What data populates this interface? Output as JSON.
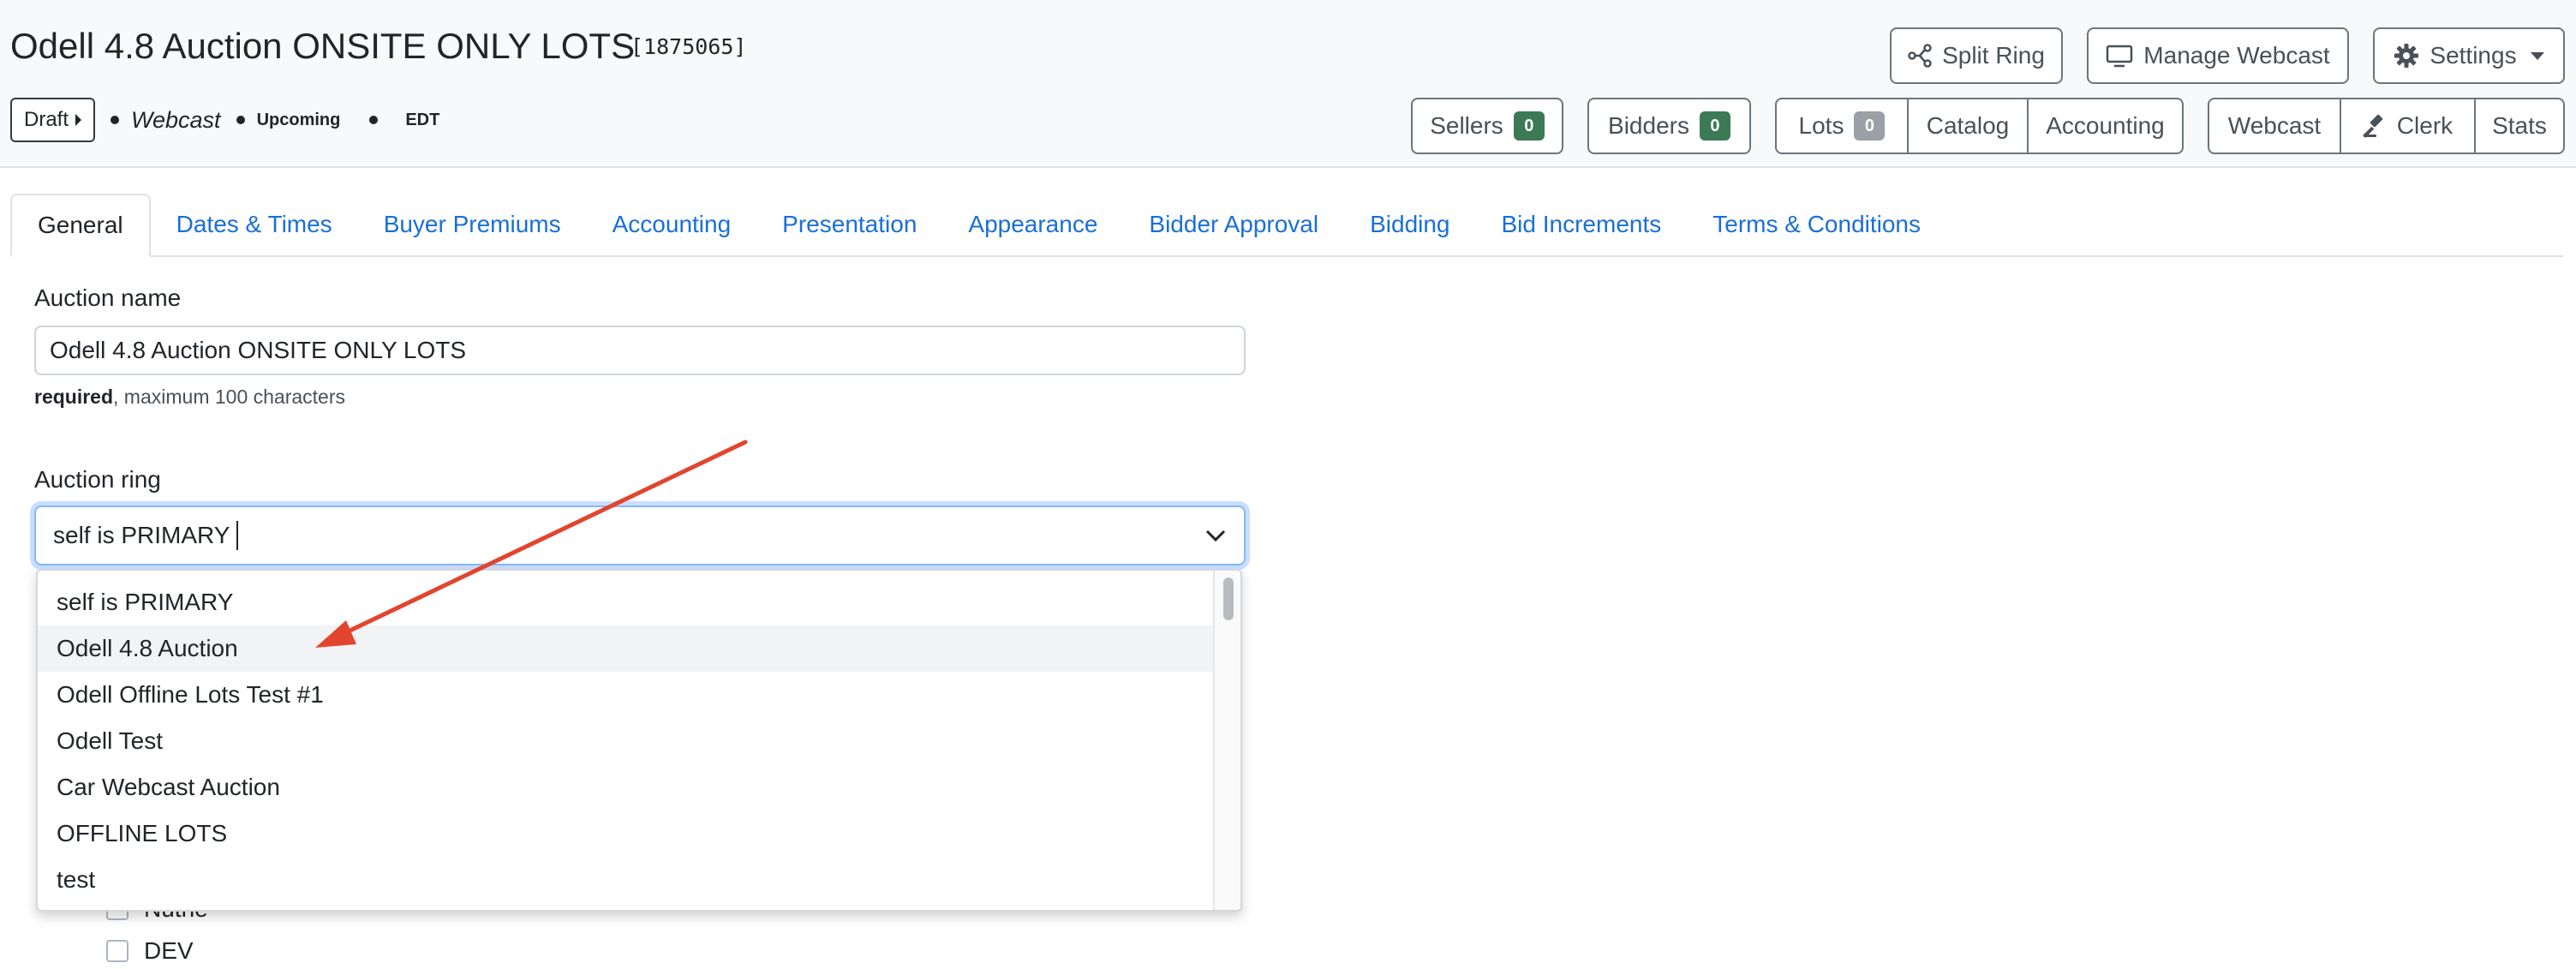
{
  "header": {
    "title": "Odell 4.8 Auction ONSITE ONLY LOTS",
    "id": "[1875065]",
    "status": {
      "draft_label": "Draft",
      "type": "Webcast",
      "phase": "Upcoming",
      "timezone": "EDT"
    },
    "actions": {
      "split_ring": "Split Ring",
      "manage_webcast": "Manage Webcast",
      "settings": "Settings"
    },
    "counters": {
      "sellers_label": "Sellers",
      "sellers_count": "0",
      "bidders_label": "Bidders",
      "bidders_count": "0"
    },
    "group_lots": {
      "lots_label": "Lots",
      "lots_count": "0",
      "catalog": "Catalog",
      "accounting": "Accounting"
    },
    "group_live": {
      "webcast": "Webcast",
      "clerk": "Clerk",
      "stats": "Stats"
    }
  },
  "tabs": [
    {
      "label": "General",
      "active": true
    },
    {
      "label": "Dates & Times"
    },
    {
      "label": "Buyer Premiums"
    },
    {
      "label": "Accounting"
    },
    {
      "label": "Presentation"
    },
    {
      "label": "Appearance"
    },
    {
      "label": "Bidder Approval"
    },
    {
      "label": "Bidding"
    },
    {
      "label": "Bid Increments"
    },
    {
      "label": "Terms & Conditions"
    }
  ],
  "form": {
    "auction_name": {
      "label": "Auction name",
      "value": "Odell 4.8 Auction ONSITE ONLY LOTS",
      "help_required": "required",
      "help_rest": ", maximum 100 characters"
    },
    "auction_ring": {
      "label": "Auction ring",
      "value": "self is PRIMARY",
      "options": [
        "self is PRIMARY",
        "Odell 4.8 Auction",
        "Odell Offline Lots Test #1",
        "Odell Test",
        "Car Webcast Auction",
        "OFFLINE LOTS",
        "test"
      ],
      "highlighted_index": 1
    },
    "checkboxes": [
      "Nuthe",
      "DEV"
    ]
  },
  "colors": {
    "link": "#1a6fd6",
    "badge_green": "#3c7a55",
    "badge_grey": "#9aa0a6",
    "annotation_arrow": "#e2452e",
    "focus_ring": "#86b7fe"
  }
}
